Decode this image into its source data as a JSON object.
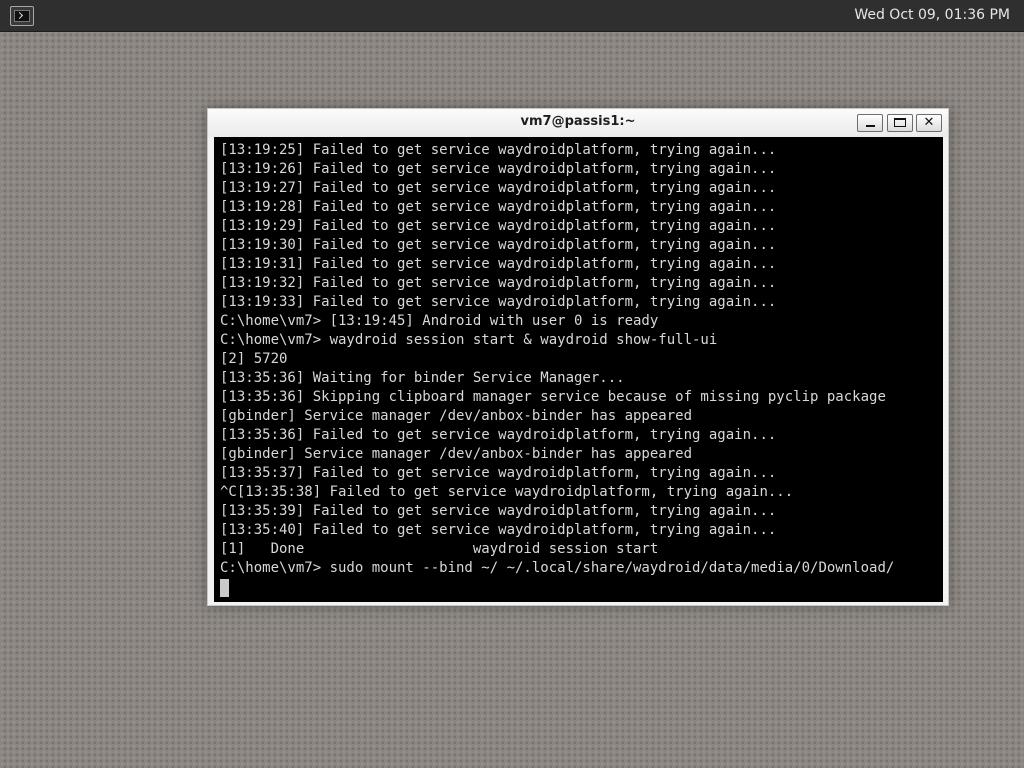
{
  "panel": {
    "clock": "Wed Oct 09, 01:36 PM",
    "app_icon": "terminal-icon"
  },
  "window": {
    "title": "vm7@passis1:~",
    "buttons": {
      "minimize": "minimize-icon",
      "maximize": "maximize-icon",
      "close": "✕"
    }
  },
  "terminal": {
    "lines": [
      "[13:19:25] Failed to get service waydroidplatform, trying again...",
      "[13:19:26] Failed to get service waydroidplatform, trying again...",
      "[13:19:27] Failed to get service waydroidplatform, trying again...",
      "[13:19:28] Failed to get service waydroidplatform, trying again...",
      "[13:19:29] Failed to get service waydroidplatform, trying again...",
      "[13:19:30] Failed to get service waydroidplatform, trying again...",
      "[13:19:31] Failed to get service waydroidplatform, trying again...",
      "[13:19:32] Failed to get service waydroidplatform, trying again...",
      "[13:19:33] Failed to get service waydroidplatform, trying again...",
      "C:\\home\\vm7> [13:19:45] Android with user 0 is ready",
      "C:\\home\\vm7> waydroid session start & waydroid show-full-ui",
      "[2] 5720",
      "[13:35:36] Waiting for binder Service Manager...",
      "[13:35:36] Skipping clipboard manager service because of missing pyclip package",
      "[gbinder] Service manager /dev/anbox-binder has appeared",
      "[13:35:36] Failed to get service waydroidplatform, trying again...",
      "[gbinder] Service manager /dev/anbox-binder has appeared",
      "[13:35:37] Failed to get service waydroidplatform, trying again...",
      "^C[13:35:38] Failed to get service waydroidplatform, trying again...",
      "[13:35:39] Failed to get service waydroidplatform, trying again...",
      "[13:35:40] Failed to get service waydroidplatform, trying again...",
      "[1]   Done                    waydroid session start",
      "C:\\home\\vm7> sudo mount --bind ~/ ~/.local/share/waydroid/data/media/0/Download/"
    ]
  }
}
